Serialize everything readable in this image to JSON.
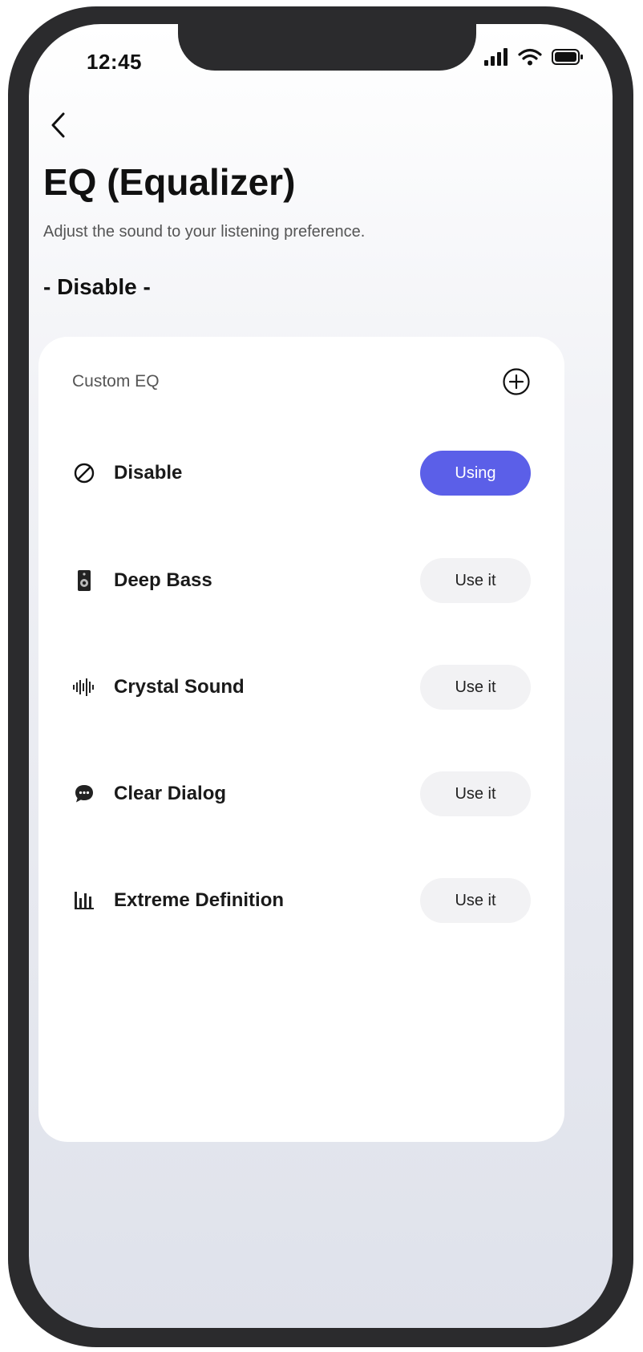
{
  "status_bar": {
    "time": "12:45",
    "icons": [
      "signal-icon",
      "wifi-icon",
      "battery-icon"
    ]
  },
  "header": {
    "back_icon": "chevron-left-icon",
    "title": "EQ (Equalizer)",
    "subtitle": "Adjust the sound to your listening preference.",
    "current_eq": "- Disable -"
  },
  "card": {
    "header_label": "Custom EQ",
    "add_icon": "plus-circle-icon",
    "items": [
      {
        "icon": "prohibited-icon",
        "name": "Disable",
        "button_label": "Using",
        "active": true
      },
      {
        "icon": "speaker-icon",
        "name": "Deep Bass",
        "button_label": "Use it",
        "active": false
      },
      {
        "icon": "sound-wave-icon",
        "name": "Crystal Sound",
        "button_label": "Use it",
        "active": false
      },
      {
        "icon": "chat-bubble-icon",
        "name": "Clear Dialog",
        "button_label": "Use it",
        "active": false
      },
      {
        "icon": "equalizer-bars-icon",
        "name": "Extreme Definition",
        "button_label": "Use it",
        "active": false
      }
    ]
  },
  "colors": {
    "accent": "#5b5fe8",
    "inactive_button": "#f2f2f4",
    "phone_frame": "#2b2b2d"
  }
}
